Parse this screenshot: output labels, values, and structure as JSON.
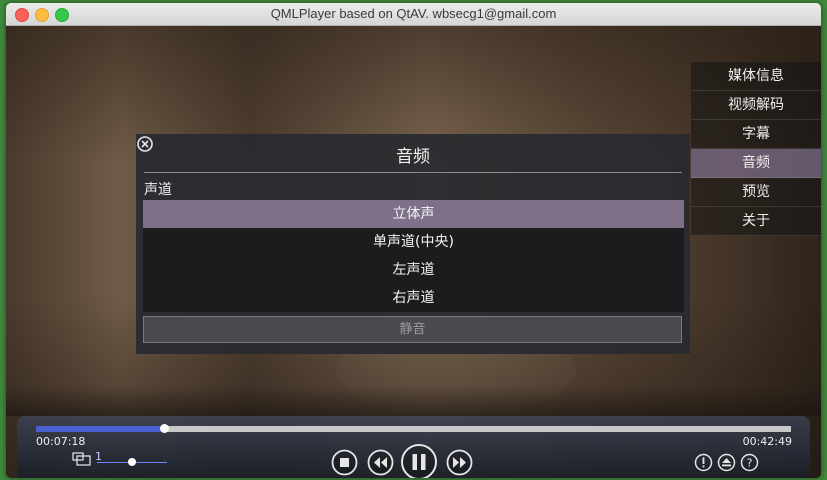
{
  "window": {
    "title": "QMLPlayer based on QtAV. wbsecg1@gmail.com"
  },
  "side_menu": {
    "items": [
      {
        "label": "媒体信息",
        "active": false
      },
      {
        "label": "视频解码",
        "active": false
      },
      {
        "label": "字幕",
        "active": false
      },
      {
        "label": "音频",
        "active": true
      },
      {
        "label": "预览",
        "active": false
      },
      {
        "label": "关于",
        "active": false
      }
    ]
  },
  "audio_panel": {
    "title": "音频",
    "channel_label": "声道",
    "channels": [
      {
        "label": "立体声",
        "selected": true
      },
      {
        "label": "单声道(中央)",
        "selected": false
      },
      {
        "label": "左声道",
        "selected": false
      },
      {
        "label": "右声道",
        "selected": false
      }
    ],
    "mute_label": "静音"
  },
  "player": {
    "current_time": "00:07:18",
    "total_time": "00:42:49",
    "progress_fraction": 0.17,
    "speed_value": "1",
    "speed_fraction": 0.5,
    "accent_color": "#4a5fd0"
  },
  "icons": {
    "close": "close-circle-icon",
    "stop": "stop-icon",
    "rewind": "rewind-icon",
    "pause": "pause-icon",
    "forward": "fast-forward-icon",
    "info": "info-icon",
    "eject": "eject-icon",
    "help": "help-icon"
  }
}
